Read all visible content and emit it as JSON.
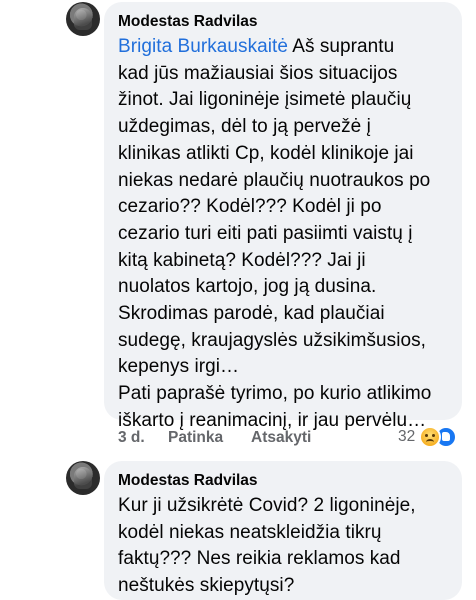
{
  "comments": [
    {
      "author": "Modestas Radvilas",
      "mention": "Brigita Burkauskaitė",
      "text_lines": [
        " Aš suprantu",
        "kad jūs mažiausiai šios situacijos",
        "žinot. Jai ligoninėje įsimetė plaučių",
        "uždegimas, dėl to ją pervežė į",
        "klinikas atlikti Cp, kodėl klinikoje jai",
        "niekas nedarė plaučių nuotraukos po",
        "cezario?? Kodėl??? Kodėl ji po",
        "cezario turi eiti pati pasiimti vaistų į",
        "kitą kabinetą? Kodėl??? Jai ji",
        "nuolatos kartojo, jog ją dusina.",
        "Skrodimas parodė, kad plaučiai",
        "sudegę, kraujagyslės užsikimšusios,",
        "kepenys irgi…",
        "Pati paprašė tyrimo, po kurio atlikimo",
        "iškarto į reanimacinį, ir jau pervėlu…"
      ],
      "time": "3 d.",
      "like_label": "Patinka",
      "reply_label": "Atsakyti",
      "reaction_count": "32",
      "reaction_icons": [
        "sad-icon",
        "like-icon"
      ]
    },
    {
      "author": "Modestas Radvilas",
      "text_lines": [
        "Kur ji užsikrėtė Covid? 2 ligoninėje,",
        "kodėl niekas neatskleidžia tikrų",
        "faktų??? Nes reikia reklamos kad",
        "neštukės skiepytųsi?"
      ]
    }
  ]
}
